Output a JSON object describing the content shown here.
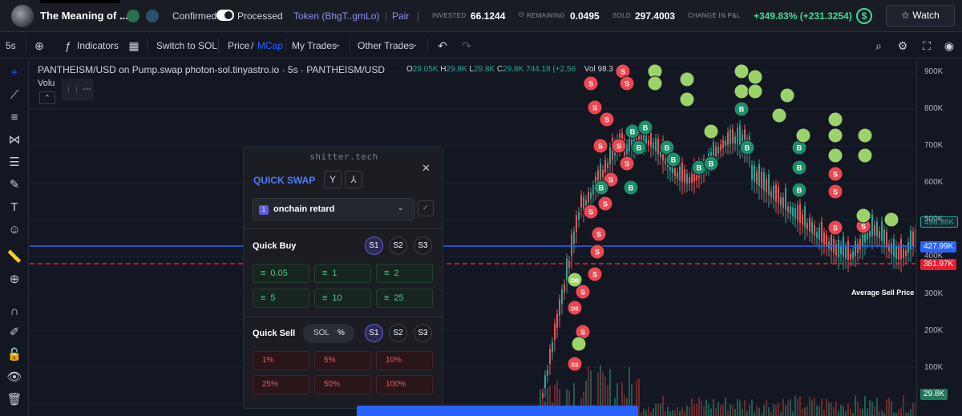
{
  "header": {
    "title": "The Meaning of ...",
    "confirmed_label": "Confirmed",
    "processed_label": "Processed",
    "token_label": "Token (BhgT..gmLo)",
    "pair_label": "Pair",
    "invested_label": "INVESTED",
    "invested_value": "66.1244",
    "remaining_label": "REMAINING",
    "remaining_value": "0.0495",
    "sold_label": "SOLD",
    "sold_value": "297.4003",
    "pnl_label": "CHANGE IN P&L",
    "pnl_value": "+349.83% (+231.3254)",
    "watch_label": "Watch"
  },
  "toolbar": {
    "interval": "5s",
    "indicators": "Indicators",
    "switch": "Switch to SOL",
    "price": "Price",
    "separator": "/",
    "mcap": "MCap",
    "my_trades": "My Trades",
    "other_trades": "Other Trades"
  },
  "chart": {
    "legend": "PANTHEISM/USD on Pump.swap photon-sol.tinyastro.io · 5s · PANTHEISM/USD",
    "ohlc": {
      "o": "29.05K",
      "h": "29.8K",
      "l": "29.8K",
      "c": "29.8K",
      "change": "744.18 (+2.56"
    },
    "volume_label": "Volu",
    "vol_indicator": "Vol 98.3",
    "average_sell_label": "Average Sell Price",
    "axis_ticks": [
      "900K",
      "800K",
      "700K",
      "600K",
      "500K",
      "400K",
      "300K",
      "200K",
      "100K"
    ],
    "price_tags": {
      "current": "496.98K",
      "blue": "427.99K",
      "red": "381.97K",
      "volume": "29.8K"
    },
    "colors": {
      "up": "#26a69a",
      "down": "#ef5350",
      "blue_line": "#2962ff",
      "sell_line": "#ff1f3a"
    }
  },
  "panel": {
    "brand": "shitter.tech",
    "title": "QUICK SWAP",
    "wallet": "onchain retard",
    "wallet_index": "1",
    "quick_buy_label": "Quick Buy",
    "quick_sell_label": "Quick Sell",
    "slots": [
      "S1",
      "S2",
      "S3"
    ],
    "buy_amounts": [
      "0.05",
      "1",
      "2",
      "5",
      "10",
      "25"
    ],
    "sell_unit_sol": "SOL",
    "sell_unit_pct": "%",
    "sell_percents": [
      "1%",
      "5%",
      "10%",
      "25%",
      "50%",
      "100%"
    ]
  }
}
